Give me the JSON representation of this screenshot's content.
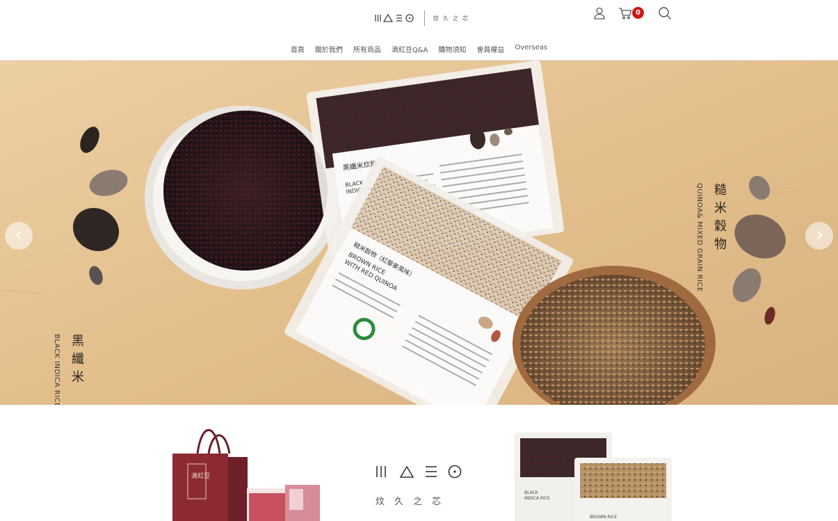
{
  "brand": {
    "logo_cn": "炆久之芯",
    "mid_cn": "炆久之芯"
  },
  "header": {
    "cart_count": "0"
  },
  "nav": {
    "items": [
      "首頁",
      "關於我們",
      "所有商品",
      "滴紅豆Q&A",
      "購物須知",
      "會員權益",
      "Overseas"
    ]
  },
  "hero": {
    "left": {
      "cn": "黑纖米",
      "en": "BLACK INDICA RICE"
    },
    "right": {
      "cn": "糙米穀物",
      "en": "QUINOA& MIXED GRAIN RICE"
    },
    "pack1": {
      "cn": "黑纖米炊飯",
      "en1": "BLACK",
      "en2": "INDICA RICE"
    },
    "pack2": {
      "cn": "糙米穀物（紅藜麥風味）",
      "en1": "BROWN RICE",
      "en2": "WITH RED QUINOA"
    },
    "slides": 2,
    "active_slide": 1
  },
  "bottom": {
    "gift_label": "滴紅豆",
    "pack_left_en1": "BLACK",
    "pack_left_en2": "INDICA RICE",
    "pack_right_en": "BROWN RICE"
  },
  "colors": {
    "accent": "#d01818",
    "hero_bg": "#e8c79a",
    "gift_red": "#8c2a34"
  }
}
